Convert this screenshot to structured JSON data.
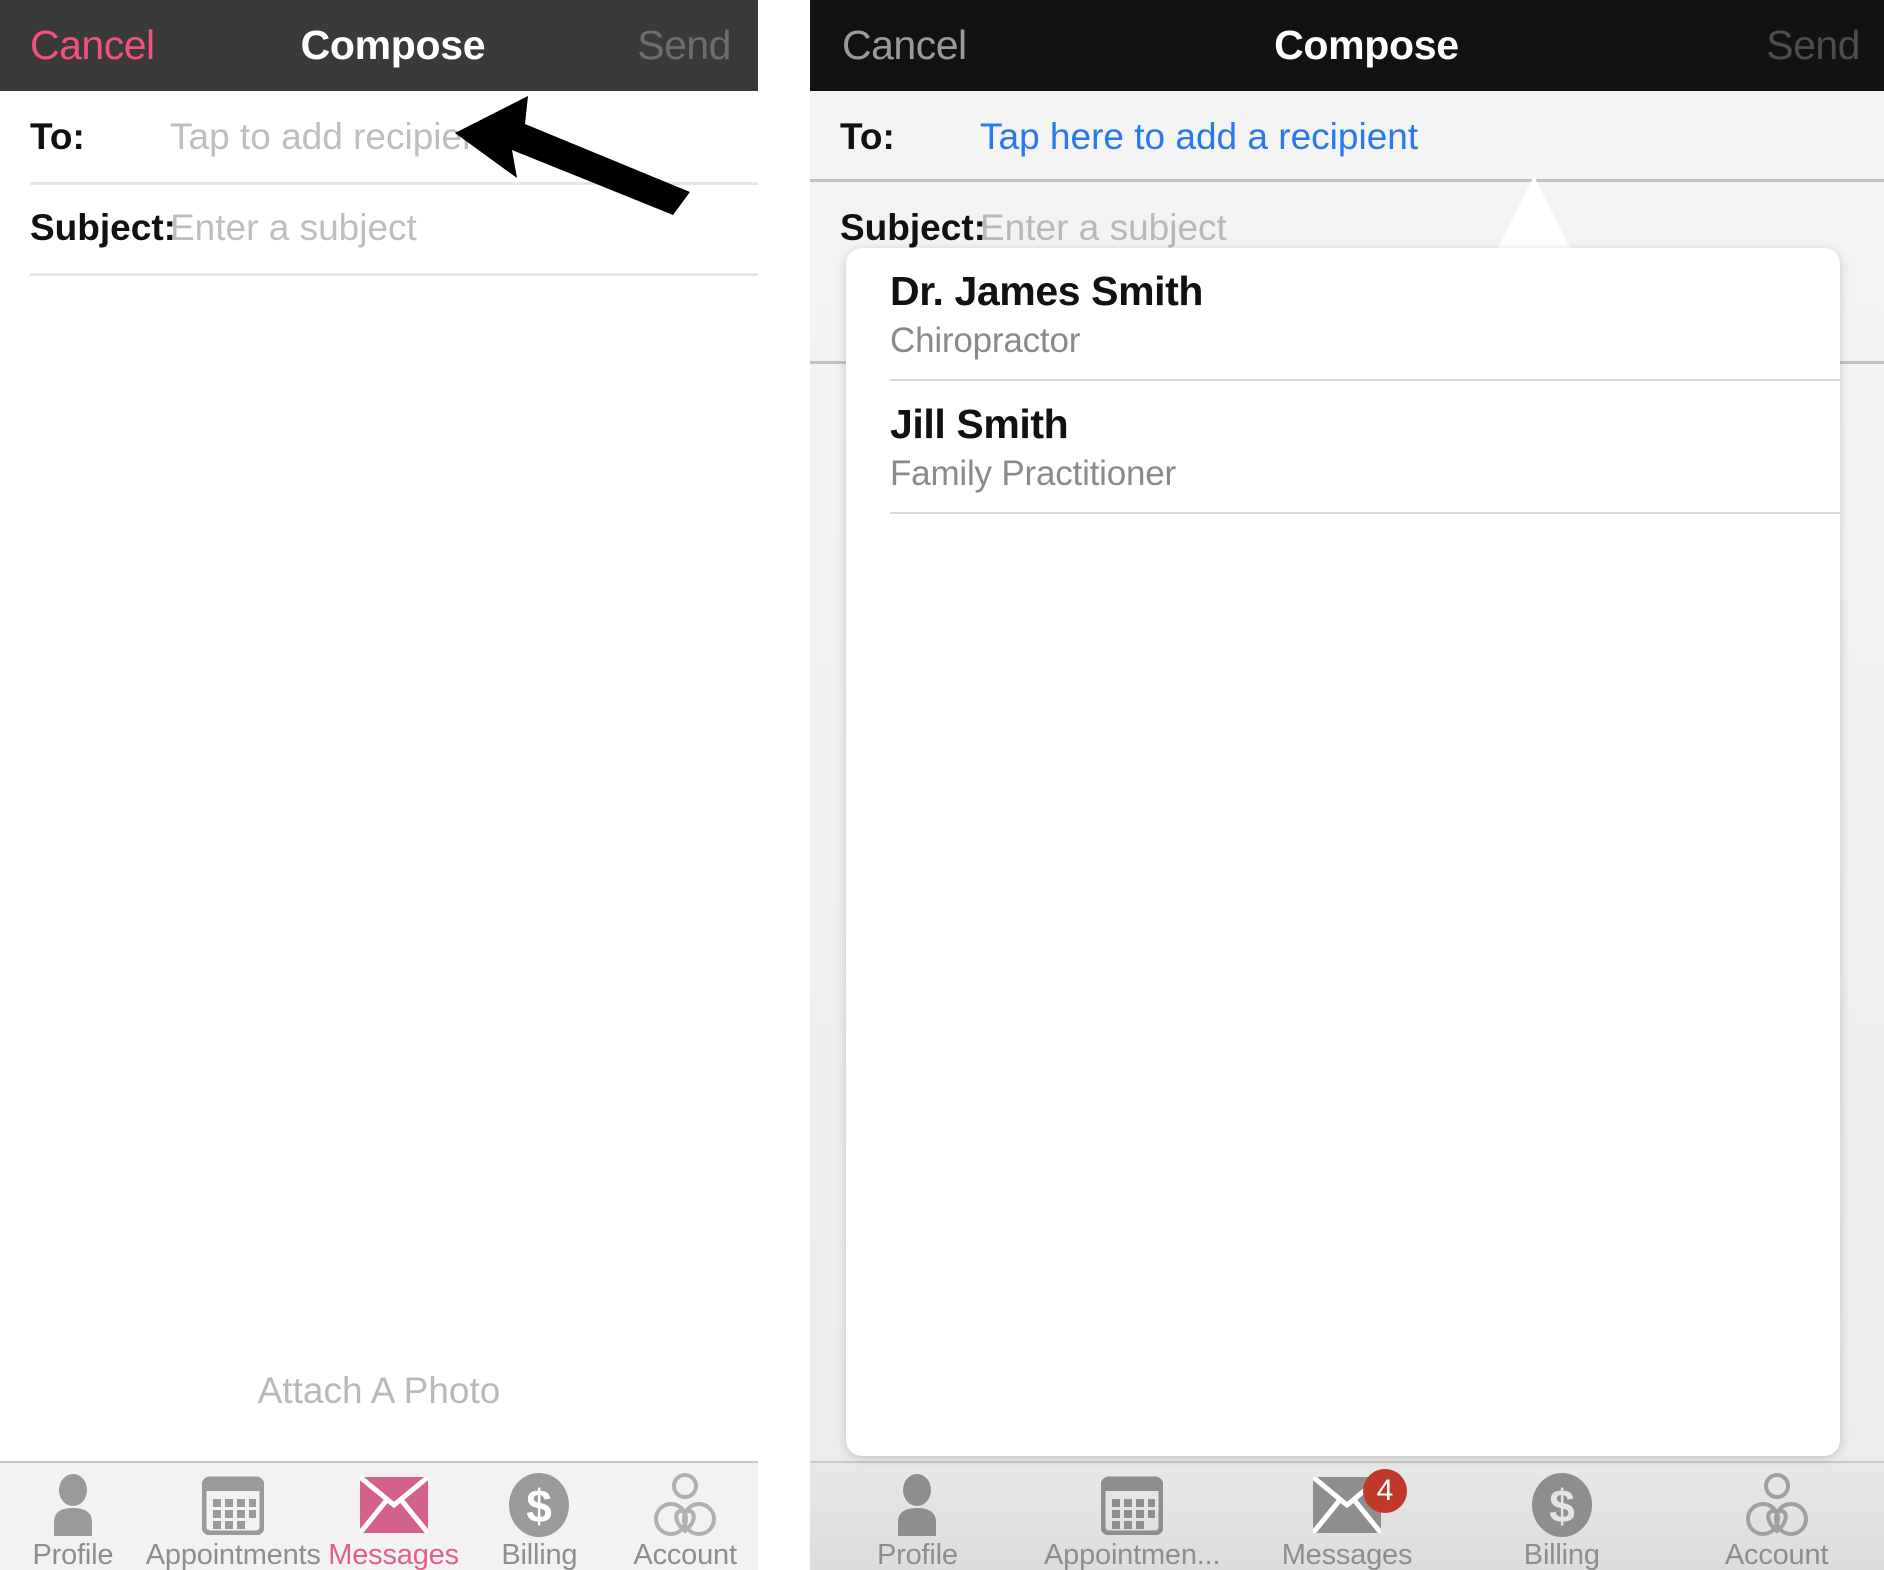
{
  "colors": {
    "cancel_pink": "#f2517b",
    "active_tab_pink": "#e0608c",
    "link_blue": "#2878f0",
    "badge_red": "#c0392b",
    "icon_gray": "#9a9a9a",
    "navbar_dark": "#3b3a3a",
    "navbar_black": "#121212",
    "placeholder_gray": "#bdbdc2"
  },
  "left_screen": {
    "navbar": {
      "cancel_label": "Cancel",
      "title": "Compose",
      "send_label": "Send"
    },
    "form": {
      "to_label": "To:",
      "to_placeholder": "Tap to add recipient",
      "subject_label": "Subject:",
      "subject_placeholder": "Enter a subject"
    },
    "attach_label": "Attach A Photo",
    "tabs": [
      {
        "label": "Profile",
        "icon": "person-icon",
        "active": false,
        "badge": ""
      },
      {
        "label": "Appointments",
        "icon": "calendar-icon",
        "active": false,
        "badge": ""
      },
      {
        "label": "Messages",
        "icon": "envelope-icon",
        "active": true,
        "badge": ""
      },
      {
        "label": "Billing",
        "icon": "dollar-icon",
        "active": false,
        "badge": ""
      },
      {
        "label": "Account",
        "icon": "heart-person-icon",
        "active": false,
        "badge": ""
      }
    ],
    "annotation": {
      "shape": "pointer-arrow",
      "points_at": "to-field-placeholder"
    }
  },
  "right_screen": {
    "navbar": {
      "cancel_label": "Cancel",
      "title": "Compose",
      "send_label": "Send"
    },
    "form": {
      "to_label": "To:",
      "to_value": "Tap here to add a recipient",
      "subject_label": "Subject:",
      "subject_placeholder": "Enter a subject"
    },
    "popover": {
      "items": [
        {
          "name": "Dr. James Smith",
          "specialty": "Chiropractor"
        },
        {
          "name": "Jill Smith",
          "specialty": "Family Practitioner"
        }
      ]
    },
    "tabs": [
      {
        "label": "Profile",
        "icon": "person-icon",
        "active": false,
        "badge": ""
      },
      {
        "label": "Appointmen...",
        "icon": "calendar-icon",
        "active": false,
        "badge": ""
      },
      {
        "label": "Messages",
        "icon": "envelope-icon",
        "active": false,
        "badge": "4"
      },
      {
        "label": "Billing",
        "icon": "dollar-icon",
        "active": false,
        "badge": ""
      },
      {
        "label": "Account",
        "icon": "heart-person-icon",
        "active": false,
        "badge": ""
      }
    ]
  }
}
